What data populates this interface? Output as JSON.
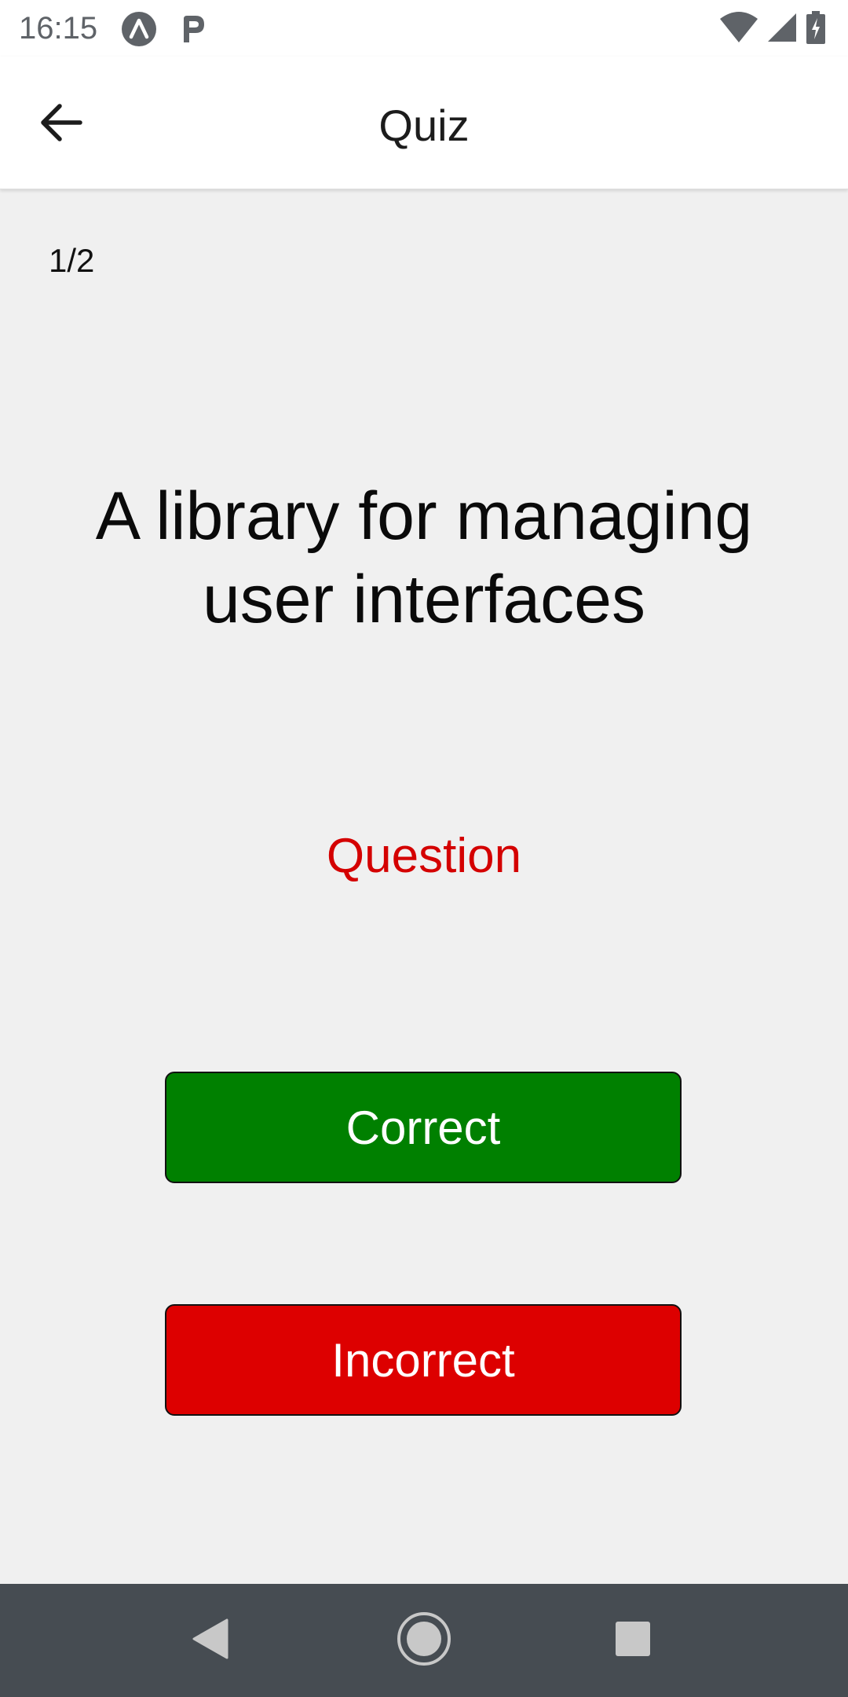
{
  "status_bar": {
    "time": "16:15",
    "notification_icons": [
      "app-notification-icon",
      "parking-notification-icon"
    ],
    "right_icons": [
      "wifi-icon",
      "cell-signal-icon",
      "battery-charging-icon"
    ]
  },
  "app_bar": {
    "title": "Quiz",
    "back_icon": "arrow-back-icon"
  },
  "quiz": {
    "progress": "1/2",
    "card_text": "A library for managing user interfaces",
    "card_side": "Question",
    "correct_label": "Correct",
    "incorrect_label": "Incorrect"
  },
  "nav_bar": {
    "icons": [
      "back-triangle-icon",
      "home-circle-icon",
      "recents-square-icon"
    ]
  },
  "colors": {
    "background": "#f0f0f0",
    "correct": "#008000",
    "incorrect": "#dd0000",
    "card_side_text": "#d40000",
    "nav_bar": "#464c52"
  }
}
